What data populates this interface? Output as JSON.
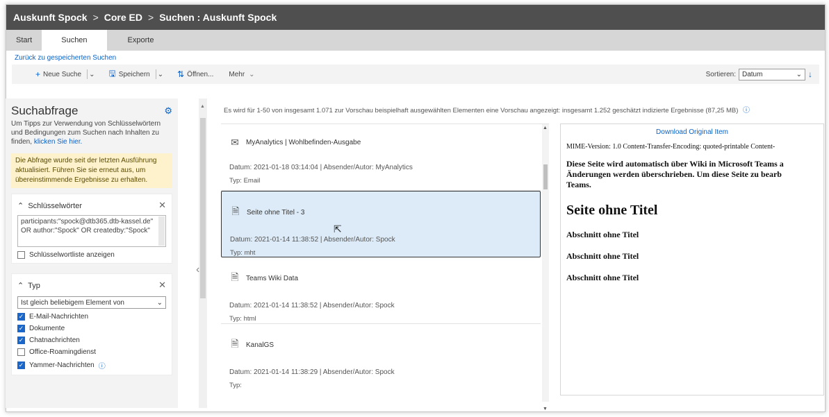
{
  "breadcrumb": [
    "Auskunft Spock",
    "Core ED",
    "Suchen : Auskunft Spock"
  ],
  "tabs": [
    "Start",
    "Suchen",
    "Exporte"
  ],
  "back_link": "Zurück zu gespeicherten Suchen",
  "toolbar": {
    "new_search": "Neue Suche",
    "save": "Speichern",
    "open": "Öffnen...",
    "more": "Mehr",
    "sort_label": "Sortieren:",
    "sort_value": "Datum"
  },
  "query_panel": {
    "title": "Suchabfrage",
    "desc": "Um Tipps zur Verwendung von Schlüsselwörtern und Bedingungen zum Suchen nach Inhalten zu finden,",
    "desc_link": "klicken Sie hier.",
    "warning": "Die Abfrage wurde seit der letzten Ausführung aktualisiert. Führen Sie sie erneut aus, um übereinstimmende Ergebnisse zu erhalten.",
    "keywords_title": "Schlüsselwörter",
    "keywords_text": "participants:\"spock@dtb365.dtb-kassel.de\" OR author:\"Spock\" OR createdby:\"Spock\"",
    "keywords_list_toggle": "Schlüsselwortliste anzeigen",
    "type_title": "Typ",
    "type_operator": "Ist gleich beliebigem Element von",
    "type_options": [
      {
        "label": "E-Mail-Nachrichten",
        "checked": true
      },
      {
        "label": "Dokumente",
        "checked": true
      },
      {
        "label": "Chatnachrichten",
        "checked": true
      },
      {
        "label": "Office-Roamingdienst",
        "checked": false
      },
      {
        "label": "Yammer-Nachrichten",
        "checked": true
      }
    ]
  },
  "results_info": "Es wird für 1-50 von insgesamt 1.071 zur Vorschau beispielhaft ausgewählten Elementen eine Vorschau angezeigt: insgesamt 1.252 geschätzt indizierte Ergebnisse (87,25 MB)",
  "results": [
    {
      "title": "MyAnalytics | Wohlbefinden-Ausgabe",
      "icon": "mail-icon",
      "meta": "Datum: 2021-01-18 03:14:04   |   Absender/Autor: MyAnalytics",
      "type": "Typ: Email"
    },
    {
      "title": "Seite ohne Titel - 3",
      "icon": "document-icon",
      "meta": "Datum: 2021-01-14 11:38:52   |   Absender/Autor: Spock",
      "type": "Typ: mht"
    },
    {
      "title": "Teams Wiki Data",
      "icon": "document-icon",
      "meta": "Datum: 2021-01-14 11:38:52   |   Absender/Autor: Spock",
      "type": "Typ: html"
    },
    {
      "title": "KanalGS",
      "icon": "document-icon",
      "meta": "Datum: 2021-01-14 11:38:29   |   Absender/Autor: Spock",
      "type": "Typ:"
    }
  ],
  "preview": {
    "download": "Download Original Item",
    "mime": "MIME-Version: 1.0 Content-Transfer-Encoding: quoted-printable Content-",
    "bold_line1": "Diese Seite wird automatisch über Wiki in Microsoft Teams a",
    "bold_line2": "Änderungen werden überschrieben. Um diese Seite zu bearb",
    "bold_line3": "Teams.",
    "heading": "Seite ohne Titel",
    "sections": [
      "Abschnitt ohne Titel",
      "Abschnitt ohne Titel",
      "Abschnitt ohne Titel"
    ]
  },
  "colors": {
    "accent": "#0a62c7",
    "titlebar": "#4f4f4f",
    "selected": "#dcebf7",
    "warning": "#fdf2cc"
  }
}
